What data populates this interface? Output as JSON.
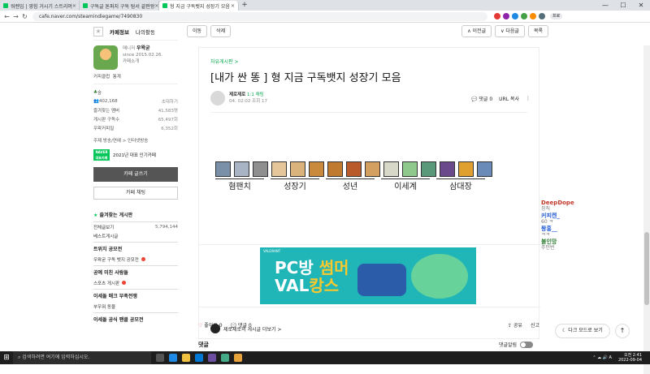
{
  "browser": {
    "tabs": [
      {
        "label": "워렌임 | 영힘 거시기 스트리머",
        "active": false
      },
      {
        "label": "구독글 톤퍼지 구독 탐서 끝판왕",
        "active": false
      },
      {
        "label": "형 지금 구독뱃지 성장기 모음",
        "active": true
      }
    ],
    "new_tab": "+",
    "url": "cafe.naver.com/steamindiegame/7490830",
    "profile": "프로",
    "window_controls": [
      "—",
      "☐",
      "✕"
    ]
  },
  "sidebar": {
    "tabs": [
      "카페정보",
      "나의활동"
    ],
    "manager_label": "매니저",
    "manager_name": "우왁굳",
    "since": "since 2015.02.26.",
    "cafe_intro": "카페소개",
    "links": [
      "커피클럽",
      "통계"
    ],
    "level": "숲",
    "members": "402,168",
    "invite": "초대하기",
    "stats": [
      {
        "label": "즐겨찾는 멤버",
        "value": "41,583명"
      },
      {
        "label": "게시판 구독수",
        "value": "65,497회"
      },
      {
        "label": "우왁커피밀",
        "value": "6,352회"
      }
    ],
    "theme": "주제 방송/연예 > 인터넷방송",
    "naver_badge": "NAVER 대표카페",
    "naver_badge_text": "2021년 대표 인기카페",
    "write_button": "카페 글쓰기",
    "chat_button": "카페 채팅",
    "favorites_head": "즐겨찾는 게시판",
    "menu": [
      {
        "label": "전체글보기",
        "value": "5,794,144"
      },
      {
        "label": "베스트게시글",
        "value": ""
      }
    ],
    "groups": [
      {
        "title": "트위치 공모전",
        "items": [
          "우왁굳 구독 뱃지 공모전"
        ]
      },
      {
        "title": "공예 미친 사람들",
        "items": [
          "스포츠 게시판"
        ]
      },
      {
        "title": "이세돌 매크 부족전쟁",
        "items": [
          "부우뭐 동물"
        ]
      },
      {
        "title": "이세돌 공식 팬클 공모전",
        "items": []
      }
    ]
  },
  "toolbar": {
    "left": [
      "이동",
      "삭제"
    ],
    "right": [
      "∧ 이전글",
      "∨ 다음글",
      "목록"
    ]
  },
  "article": {
    "board": "자유게시판 >",
    "title": "[내가 싼 똥 ] 형 지금 구독뱃지 성장기 모음",
    "writer_name": "제로제로",
    "writer_badge": "1:1 채팅",
    "date": "04. 02:02",
    "views": "조회 17",
    "comment_count_label": "댓글 0",
    "url_copy": "URL 복사",
    "char_groups": [
      {
        "label": "혐팬치",
        "count": 3
      },
      {
        "label": "성장기",
        "count": 3
      },
      {
        "label": "성년",
        "count": 3
      },
      {
        "label": "이세계",
        "count": 3
      },
      {
        "label": "삼대장",
        "count": 3
      }
    ],
    "ad": {
      "brand": "VALORANT",
      "line1a": "PC방 ",
      "line1b": "썸머",
      "line2a": "VAL",
      "line2b": "캉스"
    },
    "author_more": "제로제로의 게시글 더보기 >",
    "likes": "좋아요 0",
    "comments": "댓글 0",
    "share": "공유",
    "report": "신고",
    "comment_head": "댓글",
    "comment_sort": "댓글알림"
  },
  "chat_overlay": [
    {
      "name": "DeepDope",
      "msg": "칭칙"
    },
    {
      "name": "커피켄_",
      "msg": "60 ㅋ"
    },
    {
      "name": "퐝홍__",
      "msg": "ㅋㅋ"
    },
    {
      "name": "불인망",
      "msg": "주민번"
    }
  ],
  "dark_mode": "다크 모드로 보기",
  "scroll_up": "↑",
  "taskbar": {
    "search": "검색하려면 여기에 입력하십시오.",
    "time": "오전 2:41",
    "date": "2022-09-04"
  }
}
